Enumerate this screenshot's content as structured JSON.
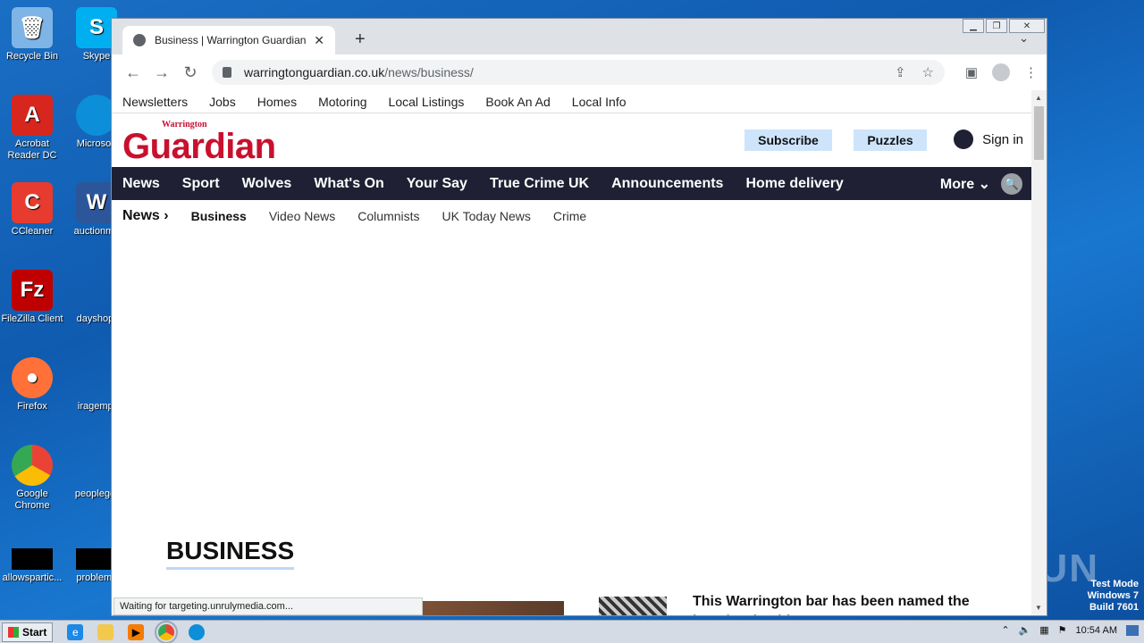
{
  "desktop": {
    "icons": [
      {
        "label": "Recycle Bin",
        "name": "recycle-bin-icon",
        "color": "#7fb4e6"
      },
      {
        "label": "Acrobat Reader DC",
        "name": "acrobat-icon",
        "color": "#d7261e"
      },
      {
        "label": "CCleaner",
        "name": "ccleaner-icon",
        "color": "#e63b2e"
      },
      {
        "label": "FileZilla Client",
        "name": "filezilla-icon",
        "color": "#bf0000"
      },
      {
        "label": "Firefox",
        "name": "firefox-icon",
        "color": "#ff7139"
      },
      {
        "label": "Google Chrome",
        "name": "chrome-icon",
        "color": "#34a853"
      },
      {
        "label": "allowspartic...",
        "name": "file-icon",
        "color": "#000000"
      }
    ],
    "icons2": [
      {
        "label": "Skype",
        "name": "skype-icon",
        "color": "#00aff0"
      },
      {
        "label": "Microsoft",
        "name": "edge-icon",
        "color": "#0c8fd8"
      },
      {
        "label": "auctionme",
        "name": "word-icon",
        "color": "#2b579a"
      },
      {
        "label": "dayshop.",
        "name": "file-icon",
        "color": "#1a6fc4"
      },
      {
        "label": "iragempl",
        "name": "file-icon",
        "color": "#1a6fc4"
      },
      {
        "label": "peopleget",
        "name": "file-icon",
        "color": "#1a6fc4"
      },
      {
        "label": "problems",
        "name": "file-icon",
        "color": "#000000"
      }
    ]
  },
  "browser": {
    "tab_title": "Business | Warrington Guardian",
    "url_host": "warringtonguardian.co.uk",
    "url_path": "/news/business/",
    "status_text": "Waiting for targeting.unrulymedia.com..."
  },
  "page": {
    "top_links": [
      "Newsletters",
      "Jobs",
      "Homes",
      "Motoring",
      "Local Listings",
      "Book An Ad",
      "Local Info"
    ],
    "logo_small": "Warrington",
    "logo_big": "Guardian",
    "subscribe": "Subscribe",
    "puzzles": "Puzzles",
    "sign_in": "Sign in",
    "main_nav": [
      "News",
      "Sport",
      "Wolves",
      "What's On",
      "Your Say",
      "True Crime UK",
      "Announcements",
      "Home delivery"
    ],
    "more": "More",
    "sub_current": "News",
    "sub_nav": [
      "Business",
      "Video News",
      "Columnists",
      "UK Today News",
      "Crime"
    ],
    "section_title": "BUSINESS",
    "article_title": "This Warrington bar has been named the best in Cheshire"
  },
  "taskbar": {
    "start": "Start",
    "clock": "10:54 AM"
  },
  "overlay": {
    "watermark": "ANY RUN",
    "test_mode": "Test Mode",
    "os": "Windows 7",
    "build": "Build 7601"
  }
}
